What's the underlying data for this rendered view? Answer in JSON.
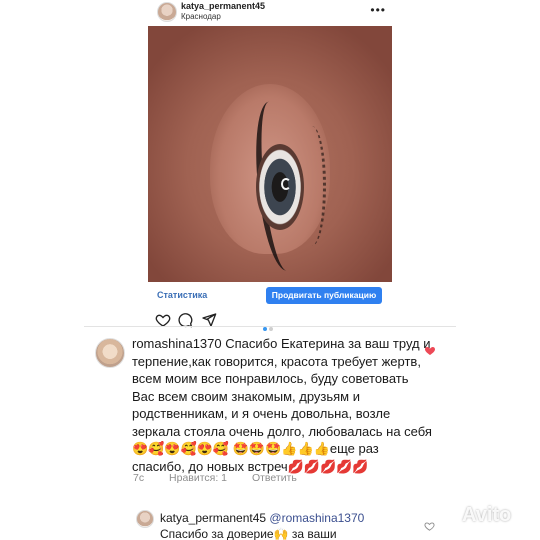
{
  "post": {
    "username": "katya_permanent45",
    "location": "Краснодар",
    "more_icon": "more-horizontal-icon"
  },
  "footer": {
    "stats_label": "Статистика",
    "promote_label": "Продвигать публикацию",
    "carousel_total": 2,
    "carousel_active": 1
  },
  "comment": {
    "username": "romashina1370",
    "text": "Спасибо Екатерина за ваш труд и терпение,как говорится, красота требует жертв, всем моим все понравилось, буду советовать Вас всем своим знакомым, друзьям и родственникам, и я очень довольна, возле зеркала стояла очень долго, любовалась на себя😍🥰😍🥰😍🥰",
    "text2": "🤩🤩🤩👍👍👍еще раз спасибо, до новых встреч💋💋💋💋💋",
    "time": "7с",
    "likes_label": "Нравится: 1",
    "reply_label": "Ответить",
    "liked": true
  },
  "reply": {
    "username": "katya_permanent45",
    "mention": "@romashina1370",
    "text": "Спасибо за доверие🙌  за ваши"
  },
  "watermark": {
    "text": "Avito"
  },
  "colors": {
    "link_blue": "#3b6fb6",
    "button_blue": "#2f80f0",
    "like_red": "#ed4956"
  }
}
